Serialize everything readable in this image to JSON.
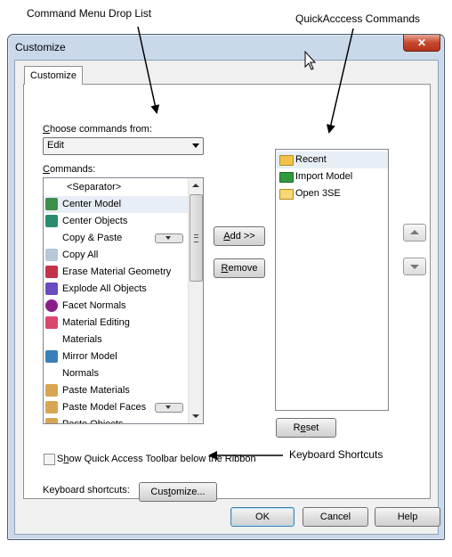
{
  "annotations": {
    "command_menu": "Command Menu Drop List",
    "quick_access": "QuickAcccess Commands",
    "keyboard_shortcuts": "Keyboard Shortcuts"
  },
  "window": {
    "title": "Customize",
    "close_glyph": "✕"
  },
  "tab": {
    "label": "Customize"
  },
  "choose": {
    "label_prefix": "C",
    "label_rest": "hoose commands from:",
    "selected": "Edit"
  },
  "commands": {
    "label_prefix": "C",
    "label_rest": "ommands:",
    "items": [
      {
        "label": "<Separator>",
        "icon": "none"
      },
      {
        "label": "Center Model",
        "icon": "center-model-icon",
        "selected": true
      },
      {
        "label": "Center Objects",
        "icon": "center-objects-icon"
      },
      {
        "label": "Copy & Paste",
        "icon": "none",
        "submenu": true
      },
      {
        "label": "Copy All",
        "icon": "copy-all-icon"
      },
      {
        "label": "Erase Material Geometry",
        "icon": "erase-icon"
      },
      {
        "label": "Explode All Objects",
        "icon": "explode-icon"
      },
      {
        "label": "Facet Normals",
        "icon": "facet-normals-icon"
      },
      {
        "label": "Material Editing",
        "icon": "material-editing-icon"
      },
      {
        "label": "Materials",
        "icon": "none"
      },
      {
        "label": "Mirror Model",
        "icon": "mirror-icon"
      },
      {
        "label": "Normals",
        "icon": "none"
      },
      {
        "label": "Paste Materials",
        "icon": "paste-icon"
      },
      {
        "label": "Paste Model Faces",
        "icon": "paste-icon",
        "submenu": true
      },
      {
        "label": "Paste Objects",
        "icon": "paste-icon"
      }
    ]
  },
  "buttons": {
    "add_prefix": "A",
    "add_rest": "dd >>",
    "remove_prefix": "R",
    "remove_rest": "emove",
    "reset_pre": "R",
    "reset_u": "e",
    "reset_rest": "set",
    "ok": "OK",
    "cancel": "Cancel",
    "help": "Help"
  },
  "quick_access": {
    "items": [
      {
        "label": "Recent",
        "icon": "folder-icon",
        "selected": true
      },
      {
        "label": "Import  Model",
        "icon": "folder-green-icon"
      },
      {
        "label": "Open 3SE",
        "icon": "folder-open-icon"
      }
    ]
  },
  "toolbar_option": {
    "pre": "S",
    "u": "h",
    "rest": "ow Quick Access Toolbar below the Ribbon"
  },
  "shortcuts": {
    "label": "Keyboard shortcuts:",
    "button_pre": "Cus",
    "button_u": "t",
    "button_rest": "omize..."
  },
  "colors": {
    "frame": "#c9d9ea",
    "close": "#c7472c",
    "selection": "#e7eef6"
  }
}
